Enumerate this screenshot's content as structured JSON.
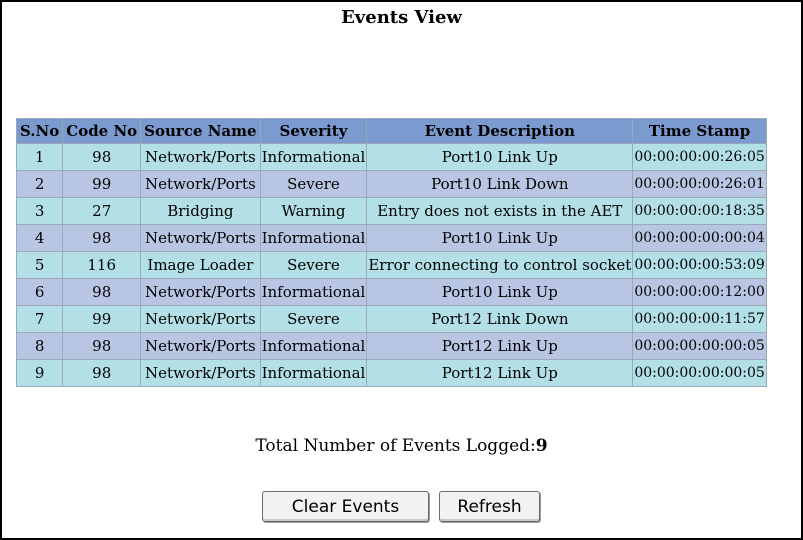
{
  "page": {
    "title": "Events View"
  },
  "table": {
    "headers": [
      "S.No",
      "Code No",
      "Source Name",
      "Severity",
      "Event Description",
      "Time Stamp"
    ],
    "rows": [
      [
        "1",
        "98",
        "Network/Ports",
        "Informational",
        "Port10 Link Up",
        "00:00:00:00:26:05"
      ],
      [
        "2",
        "99",
        "Network/Ports",
        "Severe",
        "Port10 Link Down",
        "00:00:00:00:26:01"
      ],
      [
        "3",
        "27",
        "Bridging",
        "Warning",
        "Entry does not exists in the AET",
        "00:00:00:00:18:35"
      ],
      [
        "4",
        "98",
        "Network/Ports",
        "Informational",
        "Port10 Link Up",
        "00:00:00:00:00:04"
      ],
      [
        "5",
        "116",
        "Image Loader",
        "Severe",
        "Error connecting to control socket",
        "00:00:00:00:53:09"
      ],
      [
        "6",
        "98",
        "Network/Ports",
        "Informational",
        "Port10 Link Up",
        "00:00:00:00:12:00"
      ],
      [
        "7",
        "99",
        "Network/Ports",
        "Severe",
        "Port12 Link Down",
        "00:00:00:00:11:57"
      ],
      [
        "8",
        "98",
        "Network/Ports",
        "Informational",
        "Port12 Link Up",
        "00:00:00:00:00:05"
      ],
      [
        "9",
        "98",
        "Network/Ports",
        "Informational",
        "Port12 Link Up",
        "00:00:00:00:00:05"
      ]
    ]
  },
  "summary": {
    "label": "Total Number of Events Logged:",
    "count": "9"
  },
  "buttons": {
    "clear": "Clear Events",
    "refresh": "Refresh"
  },
  "colors": {
    "header_bg": "#7b9ad0",
    "row_odd_bg": "#b3dfe6",
    "row_even_bg": "#b9c6e3"
  }
}
